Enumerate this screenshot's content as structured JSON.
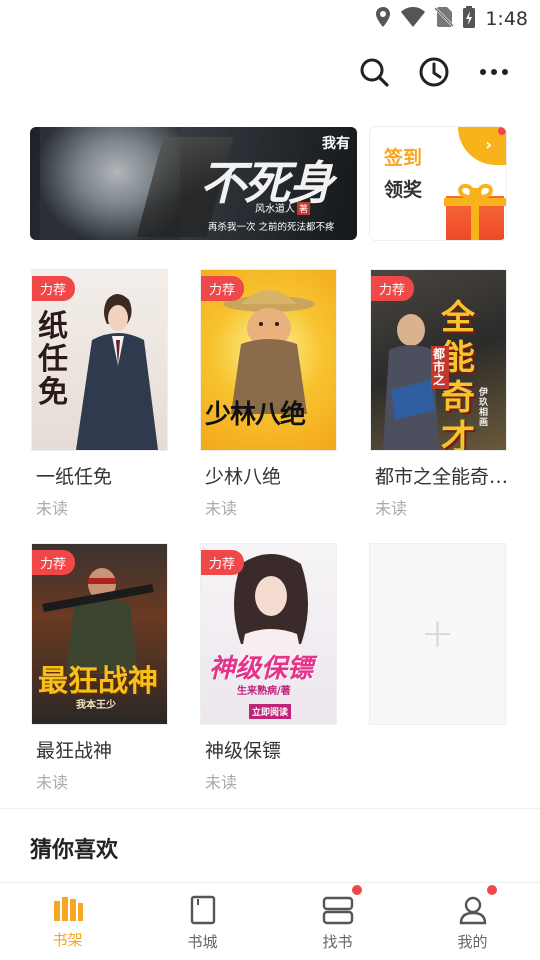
{
  "status_bar": {
    "time": "1:48"
  },
  "banner": {
    "title": "不死身",
    "title_small": "我有",
    "author": "风水道人",
    "author_seal": "著",
    "tagline": "再杀我一次 之前的死法都不疼"
  },
  "signin": {
    "line1": "签到",
    "line2": "领奖",
    "arrow": "›"
  },
  "books": [
    {
      "title": "一纸任免",
      "status": "未读",
      "badge": "力荐",
      "cover_text": "一纸任免"
    },
    {
      "title": "少林八绝",
      "status": "未读",
      "badge": "力荐",
      "cover_text": "少林八绝"
    },
    {
      "title": "都市之全能奇…",
      "status": "未读",
      "badge": "力荐",
      "cover_text": "全能奇才",
      "cover_sub": "都市之",
      "cover_author": "伊玖相画"
    },
    {
      "title": "最狂战神",
      "status": "未读",
      "badge": "力荐",
      "cover_text": "最狂战神",
      "cover_author": "我本王少"
    },
    {
      "title": "神级保镖",
      "status": "未读",
      "badge": "力荐",
      "cover_text": "神级保镖",
      "cover_author": "生来熟病/著",
      "cover_button": "立即阅读"
    }
  ],
  "add_card": {
    "symbol": "+"
  },
  "section": {
    "guess_title": "猜你喜欢"
  },
  "nav": [
    {
      "label": "书架",
      "icon": "bookshelf-icon",
      "active": true
    },
    {
      "label": "书城",
      "icon": "book-icon"
    },
    {
      "label": "找书",
      "icon": "find-book-icon"
    },
    {
      "label": "我的",
      "icon": "profile-icon"
    }
  ],
  "colors": {
    "accent": "#f5a623",
    "badge": "#f04848",
    "text_muted": "#aaaaaa"
  }
}
